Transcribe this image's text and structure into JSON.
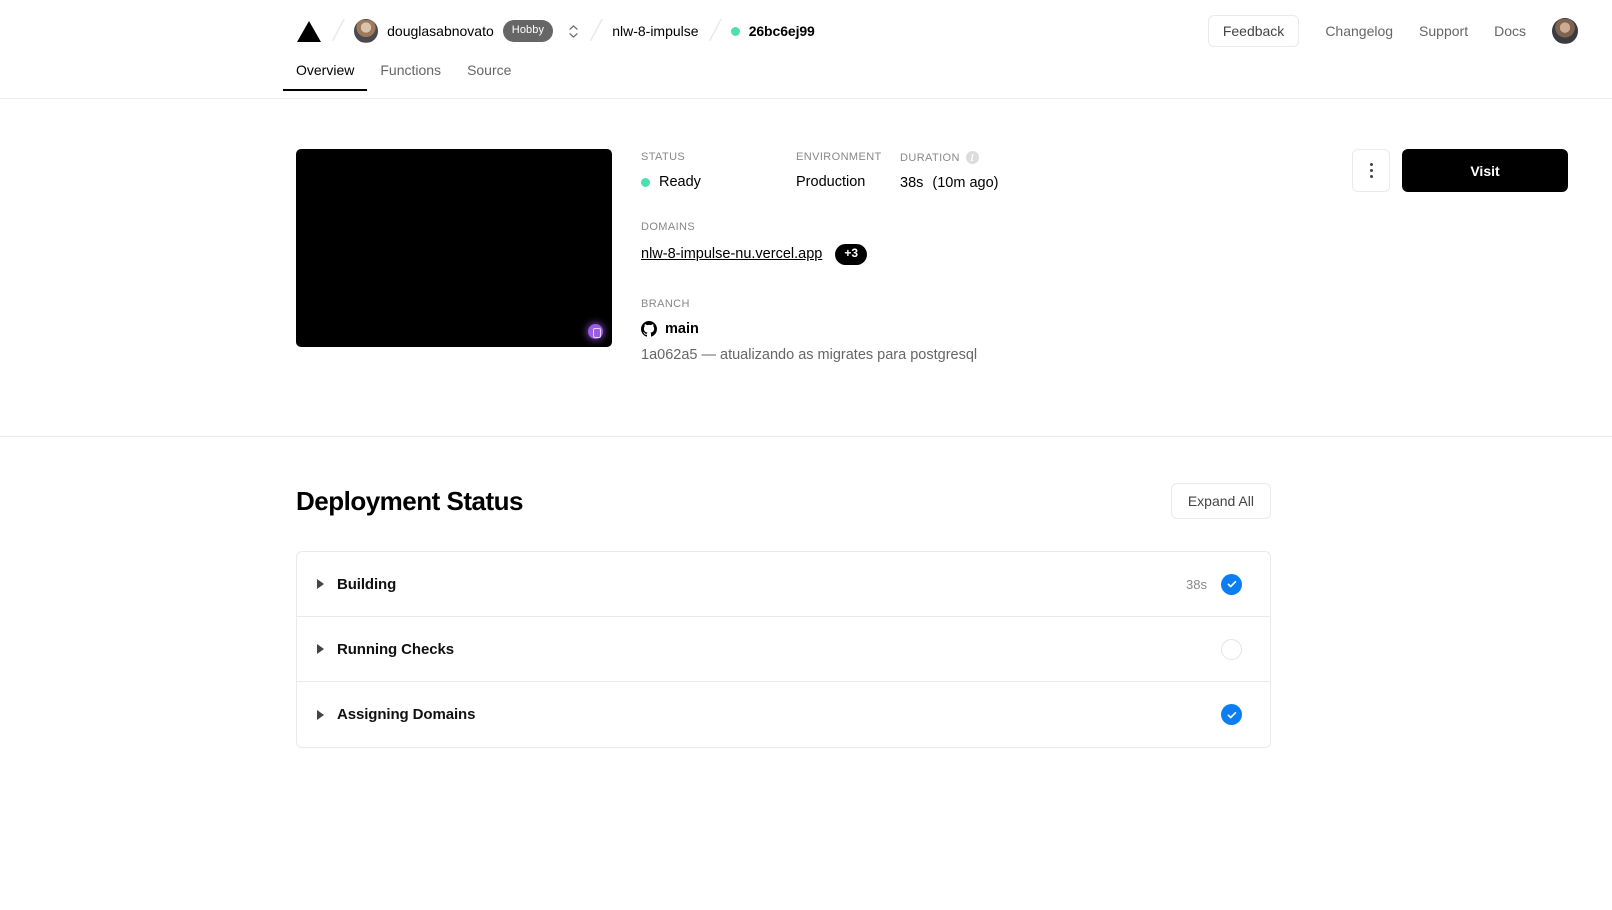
{
  "header": {
    "logo_icon": "vercel-triangle-logo",
    "separator": "/",
    "user": {
      "name": "douglasabnovato",
      "plan_badge": "Hobby",
      "avatar_icon": "user-avatar",
      "switcher_icon": "chevron-up-down-icon"
    },
    "project": {
      "name": "nlw-8-impulse"
    },
    "deployment": {
      "status_dot_color": "#4ddfb0",
      "hash": "26bc6ej99"
    },
    "feedback_button": "Feedback",
    "links": [
      "Changelog",
      "Support",
      "Docs"
    ],
    "account_avatar_icon": "account-avatar"
  },
  "tabs": [
    {
      "label": "Overview",
      "active": true
    },
    {
      "label": "Functions",
      "active": false
    },
    {
      "label": "Source",
      "active": false
    }
  ],
  "overview": {
    "preview": {
      "alt": "deployment-preview-thumbnail",
      "background_color": "#000000",
      "badge_color": "#9b5de5",
      "badge_icon": "vercel-toolbar-icon"
    },
    "status": {
      "label": "STATUS",
      "value": "Ready",
      "dot_color": "#4ddfb0"
    },
    "environment": {
      "label": "ENVIRONMENT",
      "value": "Production"
    },
    "duration": {
      "label": "DURATION",
      "info_icon": "info-icon",
      "value": "38s",
      "relative": "(10m ago)"
    },
    "domains": {
      "label": "DOMAINS",
      "primary": "nlw-8-impulse-nu.vercel.app",
      "more_badge": "+3"
    },
    "branch": {
      "label": "BRANCH",
      "icon": "github-icon",
      "name": "main",
      "commit": "1a062a5 — atualizando as migrates para postgresql"
    },
    "actions": {
      "menu_icon": "kebab-menu-icon",
      "visit_button": "Visit"
    }
  },
  "deployment_status": {
    "title": "Deployment Status",
    "expand_all_button": "Expand All",
    "rows": [
      {
        "name": "Building",
        "time": "38s",
        "state": "complete",
        "toggle_icon": "triangle-right-icon",
        "state_icon": "check-circle-icon"
      },
      {
        "name": "Running Checks",
        "time": "",
        "state": "pending",
        "toggle_icon": "triangle-right-icon",
        "state_icon": "empty-circle-icon"
      },
      {
        "name": "Assigning Domains",
        "time": "",
        "state": "complete",
        "toggle_icon": "triangle-right-icon",
        "state_icon": "check-circle-icon"
      }
    ],
    "accent_color": "#0a7ef2"
  }
}
